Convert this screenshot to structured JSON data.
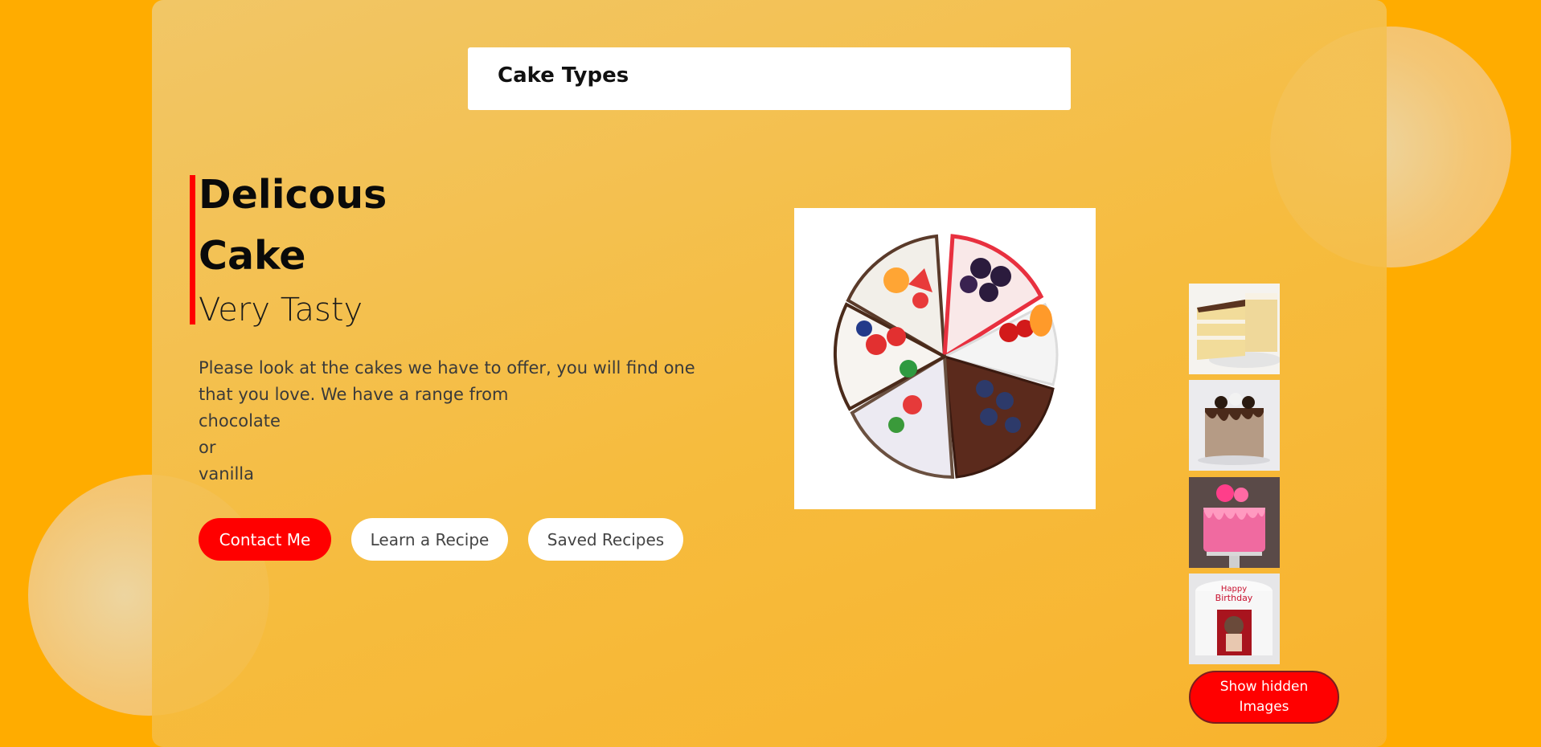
{
  "header": {
    "title": "Cake Types"
  },
  "hero": {
    "title_line1": "Delicous",
    "title_line2": "Cake",
    "subtitle": "Very Tasty",
    "description_lines": [
      "Please look at the cakes we have to offer, you will find one",
      "that you love. We have a range from",
      "chocolate",
      "or",
      "vanilla"
    ]
  },
  "buttons": {
    "contact": "Contact Me",
    "learn": "Learn a Recipe",
    "saved": "Saved Recipes"
  },
  "gallery": {
    "main_image": "cake-slices-photo",
    "thumbnails": [
      "vanilla-layer-cake-photo",
      "chocolate-drip-cake-photo",
      "pink-drip-cake-photo",
      "birthday-cake-photo"
    ],
    "show_hidden_label": "Show hidden Images"
  },
  "colors": {
    "background": "#ffac00",
    "accent": "#ff0000",
    "panel": "#f3c45f",
    "text": "#0a0a0a"
  }
}
